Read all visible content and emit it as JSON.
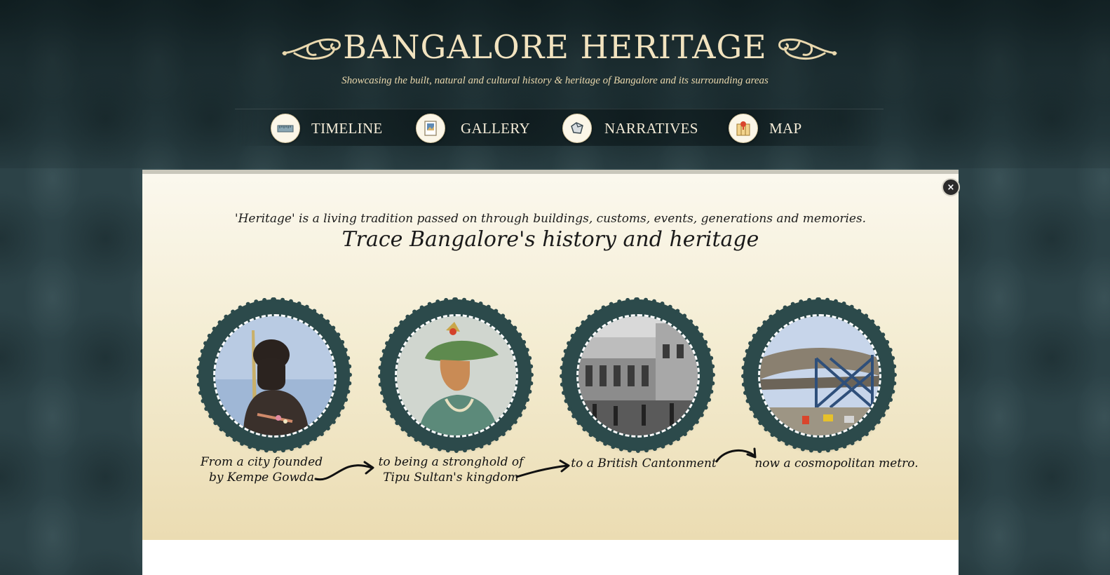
{
  "header": {
    "title": "BANGALORE HERITAGE",
    "tagline": "Showcasing the built, natural and cultural history & heritage of Bangalore and its surrounding areas"
  },
  "nav": {
    "items": [
      {
        "label": "TIMELINE",
        "icon": "ruler-icon"
      },
      {
        "label": "GALLERY",
        "icon": "photo-icon"
      },
      {
        "label": "NARRATIVES",
        "icon": "scroll-icon"
      },
      {
        "label": "MAP",
        "icon": "map-pin-icon"
      }
    ]
  },
  "panel": {
    "close_label": "×",
    "intro_line": "'Heritage' is a living tradition passed on through buildings, customs, events, generations and memories.",
    "heading": "Trace Bangalore's history and heritage",
    "eras": [
      {
        "caption_line1": "From a city founded",
        "caption_line2": "by Kempe Gowda",
        "image": "kempe-gowda-statue"
      },
      {
        "caption_line1": "to being a stronghold of",
        "caption_line2": "Tipu Sultan's kingdom",
        "image": "tipu-sultan-portrait"
      },
      {
        "caption_line1": "to a British Cantonment",
        "caption_line2": "",
        "image": "british-cantonment-building"
      },
      {
        "caption_line1": "now a cosmopolitan metro.",
        "caption_line2": "",
        "image": "metro-bridge"
      }
    ]
  },
  "colors": {
    "background": "#2c4247",
    "title": "#f2e3bf",
    "frame": "#2c4a4b",
    "panel": "#f4edd3"
  }
}
